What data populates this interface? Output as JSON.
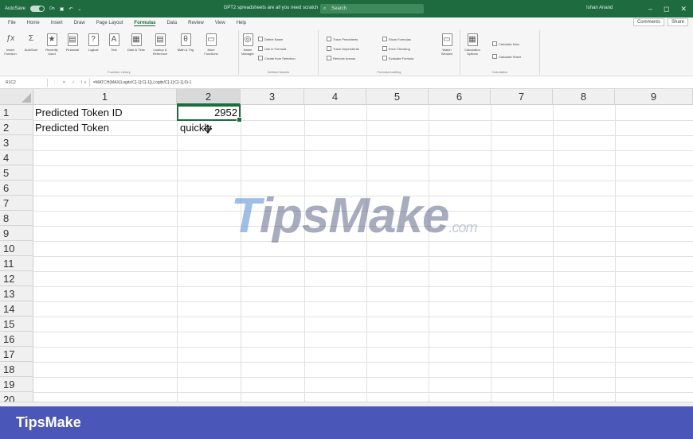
{
  "titlebar": {
    "autosave": "AutoSave",
    "autosave_state": "On",
    "doc_title": "GPT2 spreadsheets are all you need scratch",
    "search_placeholder": "Search",
    "user": "Ishan Anand",
    "controls": [
      "–",
      "◻",
      "✕"
    ]
  },
  "menu": {
    "tabs": [
      "File",
      "Home",
      "Insert",
      "Draw",
      "Page Layout",
      "Formulas",
      "Data",
      "Review",
      "View",
      "Help"
    ],
    "active": "Formulas",
    "comments": "Comments",
    "share": "Share"
  },
  "ribbon": {
    "function_library": {
      "group_label": "Function Library",
      "buttons": [
        "Insert Function",
        "AutoSum",
        "Recently Used",
        "Financial",
        "Logical",
        "Text",
        "Date & Time",
        "Lookup & Reference",
        "Math & Trig",
        "More Functions"
      ]
    },
    "defined_names": {
      "group_label": "Defined Names",
      "manager": "Name Manager",
      "items": [
        "Define Name",
        "Use in Formula",
        "Create from Selection"
      ]
    },
    "formula_auditing": {
      "group_label": "Formula Auditing",
      "items": [
        "Trace Precedents",
        "Trace Dependents",
        "Remove Arrows",
        "Show Formulas",
        "Error Checking",
        "Evaluate Formula"
      ],
      "watch": "Watch Window"
    },
    "calculation": {
      "group_label": "Calculation",
      "options": "Calculation Options",
      "items": [
        "Calculate Now",
        "Calculate Sheet"
      ]
    }
  },
  "formula_bar": {
    "name_box": "R1C2",
    "icons": "⋮ ✕ ✓ fx",
    "formula": "=MATCH(MAX(Logits!C[-1]:C[-1]),Logits!C[-1]:C[-1],0)-1"
  },
  "grid": {
    "columns": [
      "1",
      "2",
      "3",
      "4",
      "5",
      "6",
      "7",
      "8",
      "9"
    ],
    "selected_column": "2",
    "rows": [
      "1",
      "2",
      "3",
      "4",
      "5",
      "6",
      "7",
      "8",
      "9",
      "10",
      "11",
      "12",
      "13",
      "14",
      "15",
      "16",
      "17",
      "18",
      "19",
      "20"
    ],
    "cells": {
      "r1c1": "Predicted Token ID",
      "r1c2": "2952",
      "r2c1": "Predicted Token",
      "r2c2": "quickly"
    }
  },
  "watermark": {
    "t": "T",
    "rest": "ipsMake",
    "suffix": ".com"
  },
  "footer": {
    "brand": "TipsMake"
  }
}
